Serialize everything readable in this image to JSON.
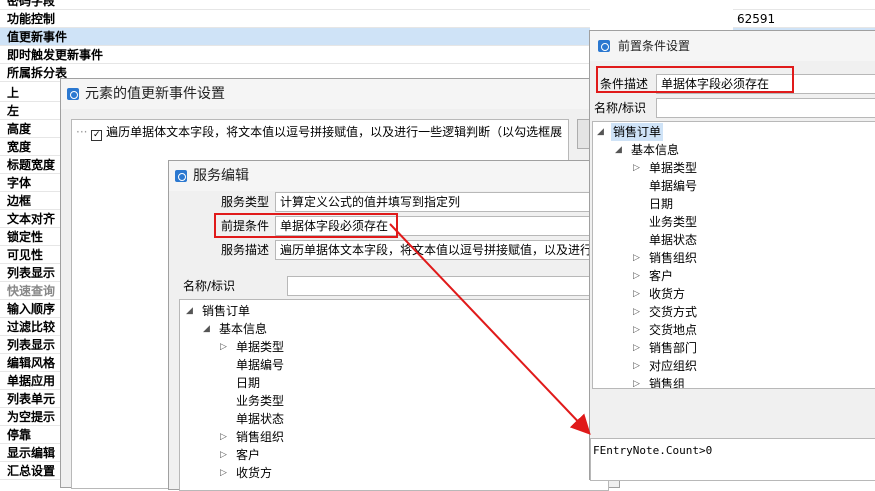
{
  "bg_props": [
    {
      "label": "密码字段",
      "selected": false
    },
    {
      "label": "功能控制",
      "selected": false
    },
    {
      "label": "值更新事件",
      "selected": true
    },
    {
      "label": "即时触发更新事件",
      "selected": false
    },
    {
      "label": "所属拆分表",
      "selected": false
    }
  ],
  "bg_value_cell": "62591",
  "bg_col_props": [
    "上",
    "左",
    "高度",
    "宽度",
    "标题宽度",
    "字体",
    "边框",
    "文本对齐",
    "锁定性",
    "可见性",
    "列表显示",
    "快速查询",
    "输入顺序",
    "过滤比较",
    "列表显示",
    "编辑风格",
    "单据应用",
    "列表单元",
    "为空提示",
    "停靠",
    "显示编辑",
    "汇总设置"
  ],
  "event_dialog": {
    "title": "元素的值更新事件设置",
    "item": "遍历单据体文本字段，将文本值以逗号拼接赋值，以及进行一些逻辑判断（以勾选框展"
  },
  "service_dialog": {
    "title": "服务编辑",
    "service_type_label": "服务类型",
    "service_type_value": "计算定义公式的值并填写到指定列",
    "precondition_label": "前提条件",
    "precondition_value": "单据体字段必须存在",
    "service_desc_label": "服务描述",
    "service_desc_value": "遍历单据体文本字段，将文本值以逗号拼接赋值，以及进行",
    "name_label": "名称/标识",
    "tree": [
      {
        "label": "销售订单",
        "level": 0,
        "arrow": "open"
      },
      {
        "label": "基本信息",
        "level": 1,
        "arrow": "open"
      },
      {
        "label": "单据类型",
        "level": 2,
        "arrow": "closed"
      },
      {
        "label": "单据编号",
        "level": 2,
        "arrow": "none"
      },
      {
        "label": "日期",
        "level": 2,
        "arrow": "none"
      },
      {
        "label": "业务类型",
        "level": 2,
        "arrow": "none"
      },
      {
        "label": "单据状态",
        "level": 2,
        "arrow": "none"
      },
      {
        "label": "销售组织",
        "level": 2,
        "arrow": "closed"
      },
      {
        "label": "客户",
        "level": 2,
        "arrow": "closed"
      },
      {
        "label": "收货方",
        "level": 2,
        "arrow": "closed"
      }
    ]
  },
  "precondition_dialog": {
    "title": "前置条件设置",
    "desc_label": "条件描述",
    "desc_value": "单据体字段必须存在",
    "name_label": "名称/标识",
    "tree": [
      {
        "label": "销售订单",
        "level": 0,
        "arrow": "open",
        "selected": true
      },
      {
        "label": "基本信息",
        "level": 1,
        "arrow": "open"
      },
      {
        "label": "单据类型",
        "level": 2,
        "arrow": "closed"
      },
      {
        "label": "单据编号",
        "level": 2,
        "arrow": "none"
      },
      {
        "label": "日期",
        "level": 2,
        "arrow": "none"
      },
      {
        "label": "业务类型",
        "level": 2,
        "arrow": "none"
      },
      {
        "label": "单据状态",
        "level": 2,
        "arrow": "none"
      },
      {
        "label": "销售组织",
        "level": 2,
        "arrow": "closed"
      },
      {
        "label": "客户",
        "level": 2,
        "arrow": "closed"
      },
      {
        "label": "收货方",
        "level": 2,
        "arrow": "closed"
      },
      {
        "label": "交货方式",
        "level": 2,
        "arrow": "closed"
      },
      {
        "label": "交货地点",
        "level": 2,
        "arrow": "closed"
      },
      {
        "label": "销售部门",
        "level": 2,
        "arrow": "closed"
      },
      {
        "label": "对应组织",
        "level": 2,
        "arrow": "closed"
      },
      {
        "label": "销售组",
        "level": 2,
        "arrow": "closed"
      }
    ],
    "expression": "FEntryNote.Count>0"
  },
  "colors": {
    "annotation": "#e01a1a",
    "selection": "#cfe3f7"
  }
}
